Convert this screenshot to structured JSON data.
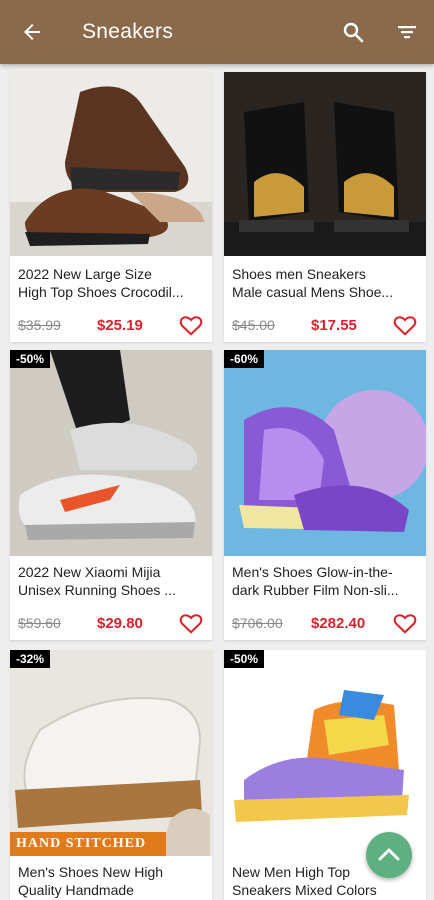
{
  "appbar": {
    "title": "Sneakers",
    "back_icon": "arrow-left-icon",
    "search_icon": "search-icon",
    "filter_icon": "filter-icon",
    "color": "#8a6a4a"
  },
  "products": [
    {
      "name_line1": "2022 New Large Size",
      "name_line2": "High Top Shoes Crocodil...",
      "old_price": "$35.99",
      "new_price": "$25.19",
      "discount": ""
    },
    {
      "name_line1": "Shoes men Sneakers",
      "name_line2": "Male casual Mens Shoe...",
      "old_price": "$45.00",
      "new_price": "$17.55",
      "discount": ""
    },
    {
      "name_line1": "2022 New Xiaomi Mijia",
      "name_line2": "Unisex Running Shoes ...",
      "old_price": "$59.60",
      "new_price": "$29.80",
      "discount": "-50%"
    },
    {
      "name_line1": "Men's Shoes Glow-in-the-",
      "name_line2": "dark Rubber Film Non-sli...",
      "old_price": "$706.00",
      "new_price": "$282.40",
      "discount": "-60%"
    },
    {
      "name_line1": "Men's Shoes New High",
      "name_line2": "Quality Handmade",
      "old_price": "",
      "new_price": "",
      "discount": "-32%",
      "overlay": "HAND STITCHED"
    },
    {
      "name_line1": "New Men High Top",
      "name_line2": "Sneakers Mixed Colors",
      "old_price": "",
      "new_price": "",
      "discount": "-50%"
    }
  ],
  "colors": {
    "price": "#d8232a",
    "heart": "#d8232a",
    "fab": "#5fb080"
  },
  "fab_icon": "chevron-up-icon"
}
